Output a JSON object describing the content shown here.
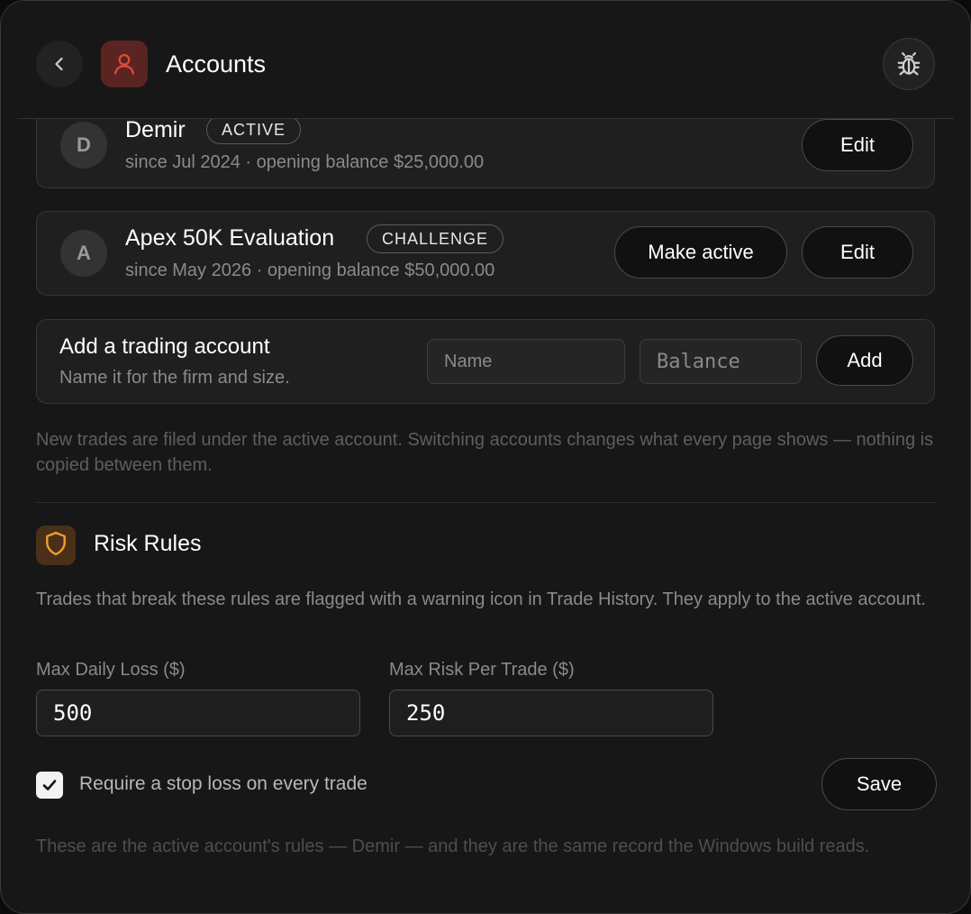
{
  "header": {
    "title": "Accounts",
    "back_icon": "chevron-left-icon",
    "app_icon": "user-icon",
    "debug_icon": "bug-icon",
    "accent": "#e0483c"
  },
  "accounts": [
    {
      "initial": "D",
      "name": "Demir",
      "badge": "ACTIVE",
      "subtitle": "since Jul 2024 · opening balance $25,000.00",
      "edit_label": "Edit"
    },
    {
      "initial": "A",
      "name": "Apex 50K Evaluation",
      "badge": "CHALLENGE",
      "subtitle": "since May 2026 · opening balance $50,000.00",
      "make_active_label": "Make active",
      "edit_label": "Edit"
    }
  ],
  "add_account": {
    "title": "Add a trading account",
    "subtitle": "Name it for the firm and size.",
    "name_placeholder": "Name",
    "balance_placeholder": "Balance",
    "add_label": "Add"
  },
  "accounts_note": "New trades are filed under the active account. Switching accounts changes what every page shows — nothing is copied between them.",
  "risk_rules": {
    "title": "Risk Rules",
    "icon": "shield-icon",
    "accent": "#f0a030",
    "description": "Trades that break these rules are flagged with a warning icon in Trade History. They apply to the active account.",
    "max_daily_loss_label": "Max Daily Loss ($)",
    "max_daily_loss_value": "500",
    "max_risk_label": "Max Risk Per Trade ($)",
    "max_risk_value": "250",
    "require_stop_label": "Require a stop loss on every trade",
    "require_stop_checked": true,
    "save_label": "Save",
    "footer": "These are the active account's rules — Demir — and they are the same record the Windows build reads."
  }
}
